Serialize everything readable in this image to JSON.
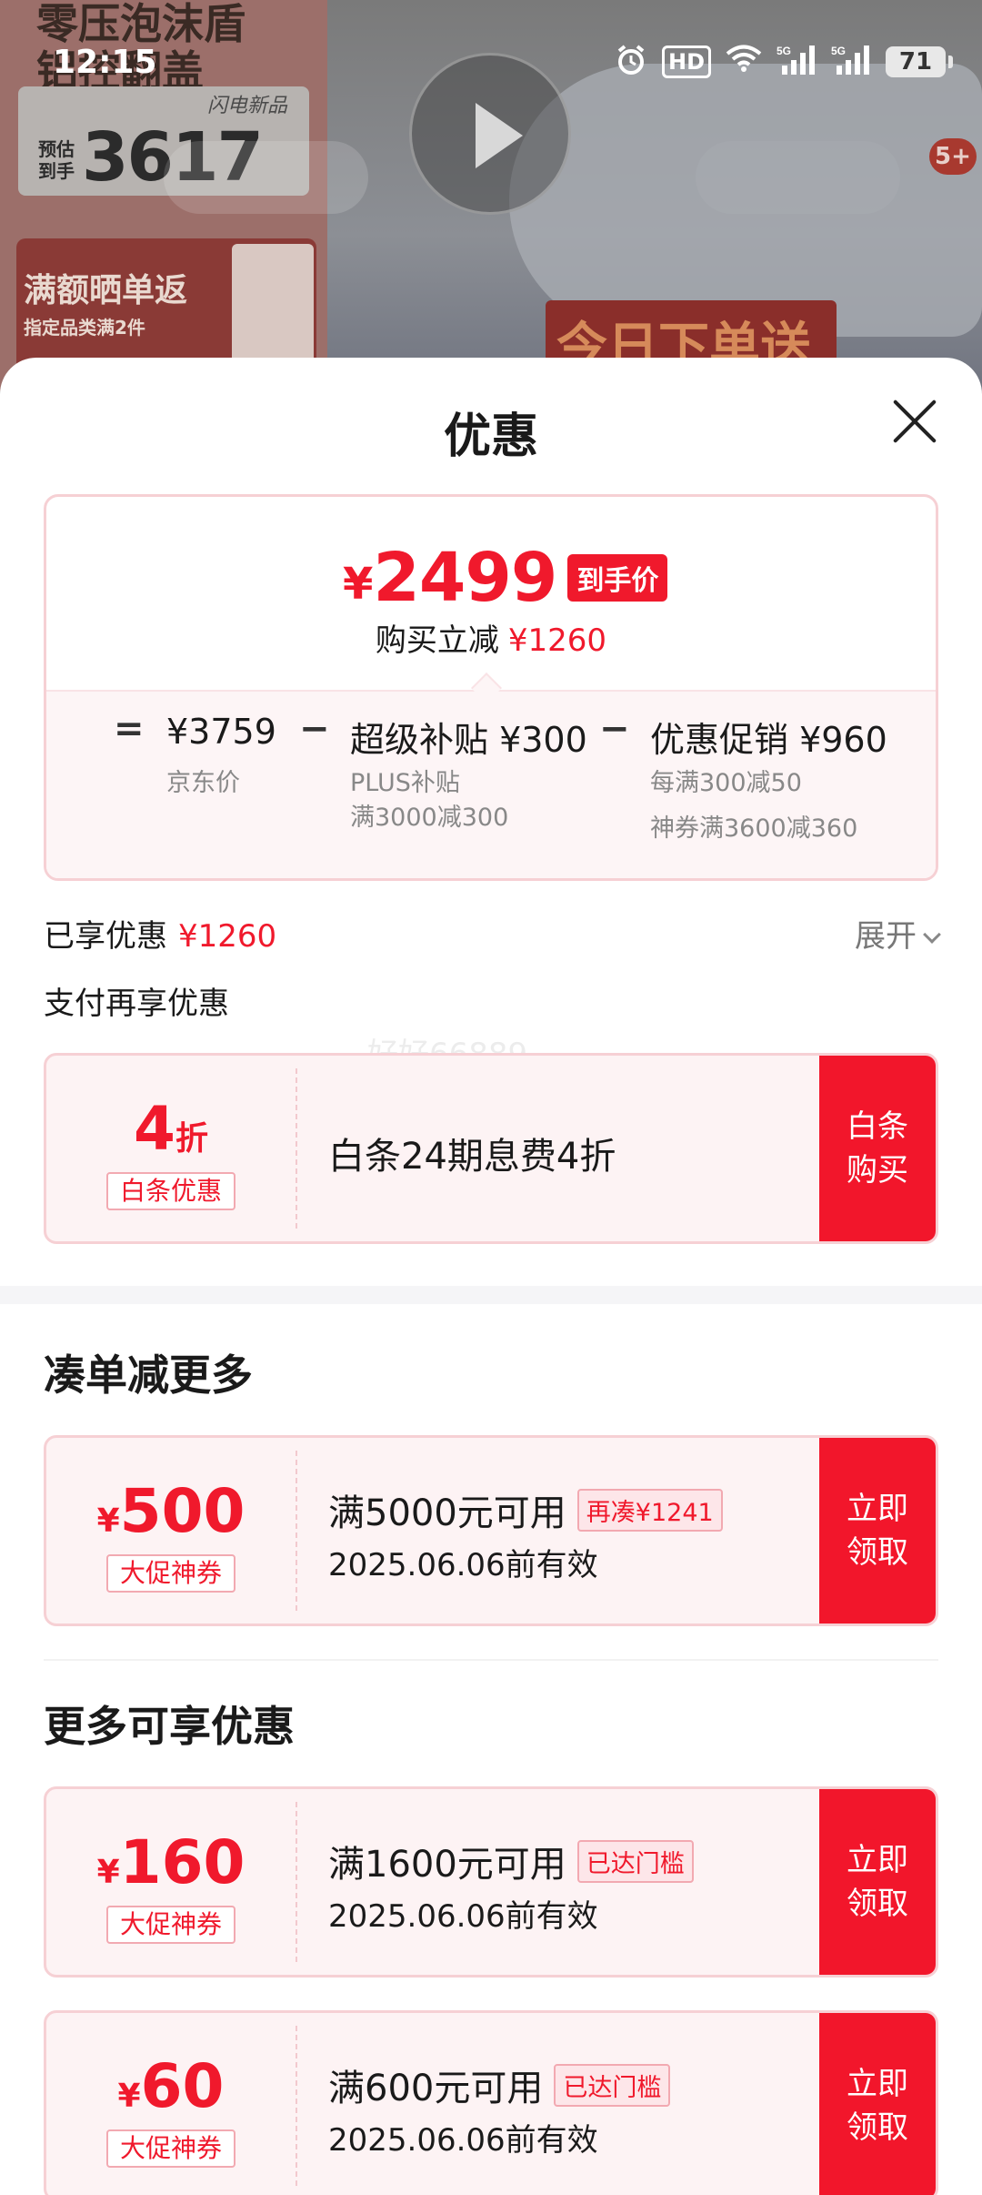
{
  "status_bar": {
    "time": "12:15",
    "battery": "71",
    "icons": [
      "alarm-icon",
      "hd-icon",
      "wifi-icon",
      "signal-5g-icon",
      "signal-5g-icon",
      "battery-icon"
    ]
  },
  "background": {
    "product_title": "零压泡沫盾\n铝控翻盖",
    "pre_tag": "预估到手",
    "price": "3617",
    "new_tag": "闪电新品",
    "promo_title": "满额晒单返",
    "promo_sub": "指定品类满2件",
    "today_text": "今日下单送",
    "badge": "5+"
  },
  "sheet": {
    "title": "优惠",
    "final_price": {
      "currency": "¥",
      "amount": "2499",
      "tag": "到手价",
      "reduce_label": "购买立减",
      "reduce_amount": "¥1260"
    },
    "breakdown": {
      "eq": "=",
      "jd_price": "¥3759",
      "jd_label": "京东价",
      "minus1": "−",
      "subsidy": "超级补贴 ¥300",
      "subsidy_note1": "PLUS补贴",
      "subsidy_note2": "满3000减300",
      "minus2": "−",
      "promo": "优惠促销 ¥960",
      "promo_note1": "每满300减50",
      "promo_note2": "神券满3600减360"
    },
    "enjoyed_label": "已享优惠",
    "enjoyed_amount": "¥1260",
    "expand_label": "展开",
    "pay_more_label": "支付再享优惠",
    "watermark": "好好66889",
    "baitiao": {
      "amount": "4",
      "unit": "折",
      "tag": "白条优惠",
      "title": "白条24期息费4折",
      "button": "白条购买"
    },
    "section_more": "凑单减更多",
    "section_enjoy": "更多可享优惠",
    "coupons": [
      {
        "currency": "¥",
        "amount": "500",
        "tag": "大促神券",
        "title": "满5000元可用",
        "badge": "再凑¥1241",
        "date": "2025.06.06前有效",
        "button": "立即领取"
      },
      {
        "currency": "¥",
        "amount": "160",
        "tag": "大促神券",
        "title": "满1600元可用",
        "badge": "已达门槛",
        "date": "2025.06.06前有效",
        "button": "立即领取"
      },
      {
        "currency": "¥",
        "amount": "60",
        "tag": "大促神券",
        "title": "满600元可用",
        "badge": "已达门槛",
        "date": "2025.06.06前有效",
        "button": "立即领取"
      }
    ]
  }
}
